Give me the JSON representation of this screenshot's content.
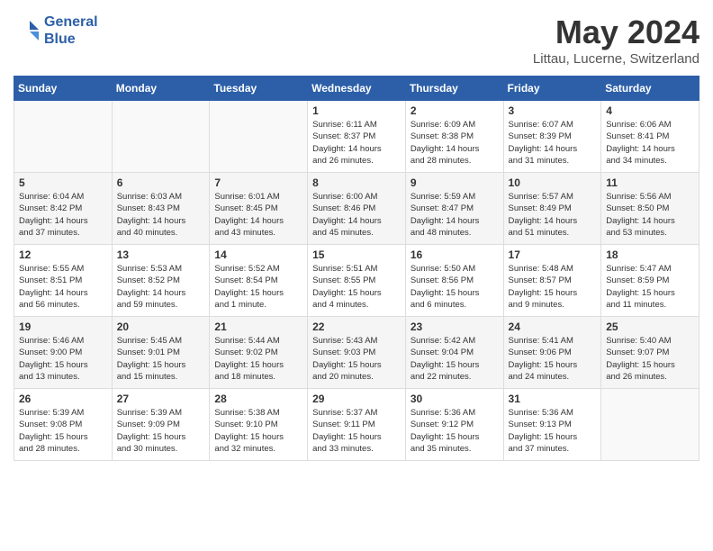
{
  "header": {
    "logo_line1": "General",
    "logo_line2": "Blue",
    "title": "May 2024",
    "subtitle": "Littau, Lucerne, Switzerland"
  },
  "weekdays": [
    "Sunday",
    "Monday",
    "Tuesday",
    "Wednesday",
    "Thursday",
    "Friday",
    "Saturday"
  ],
  "weeks": [
    [
      {
        "day": "",
        "text": ""
      },
      {
        "day": "",
        "text": ""
      },
      {
        "day": "",
        "text": ""
      },
      {
        "day": "1",
        "text": "Sunrise: 6:11 AM\nSunset: 8:37 PM\nDaylight: 14 hours\nand 26 minutes."
      },
      {
        "day": "2",
        "text": "Sunrise: 6:09 AM\nSunset: 8:38 PM\nDaylight: 14 hours\nand 28 minutes."
      },
      {
        "day": "3",
        "text": "Sunrise: 6:07 AM\nSunset: 8:39 PM\nDaylight: 14 hours\nand 31 minutes."
      },
      {
        "day": "4",
        "text": "Sunrise: 6:06 AM\nSunset: 8:41 PM\nDaylight: 14 hours\nand 34 minutes."
      }
    ],
    [
      {
        "day": "5",
        "text": "Sunrise: 6:04 AM\nSunset: 8:42 PM\nDaylight: 14 hours\nand 37 minutes."
      },
      {
        "day": "6",
        "text": "Sunrise: 6:03 AM\nSunset: 8:43 PM\nDaylight: 14 hours\nand 40 minutes."
      },
      {
        "day": "7",
        "text": "Sunrise: 6:01 AM\nSunset: 8:45 PM\nDaylight: 14 hours\nand 43 minutes."
      },
      {
        "day": "8",
        "text": "Sunrise: 6:00 AM\nSunset: 8:46 PM\nDaylight: 14 hours\nand 45 minutes."
      },
      {
        "day": "9",
        "text": "Sunrise: 5:59 AM\nSunset: 8:47 PM\nDaylight: 14 hours\nand 48 minutes."
      },
      {
        "day": "10",
        "text": "Sunrise: 5:57 AM\nSunset: 8:49 PM\nDaylight: 14 hours\nand 51 minutes."
      },
      {
        "day": "11",
        "text": "Sunrise: 5:56 AM\nSunset: 8:50 PM\nDaylight: 14 hours\nand 53 minutes."
      }
    ],
    [
      {
        "day": "12",
        "text": "Sunrise: 5:55 AM\nSunset: 8:51 PM\nDaylight: 14 hours\nand 56 minutes."
      },
      {
        "day": "13",
        "text": "Sunrise: 5:53 AM\nSunset: 8:52 PM\nDaylight: 14 hours\nand 59 minutes."
      },
      {
        "day": "14",
        "text": "Sunrise: 5:52 AM\nSunset: 8:54 PM\nDaylight: 15 hours\nand 1 minute."
      },
      {
        "day": "15",
        "text": "Sunrise: 5:51 AM\nSunset: 8:55 PM\nDaylight: 15 hours\nand 4 minutes."
      },
      {
        "day": "16",
        "text": "Sunrise: 5:50 AM\nSunset: 8:56 PM\nDaylight: 15 hours\nand 6 minutes."
      },
      {
        "day": "17",
        "text": "Sunrise: 5:48 AM\nSunset: 8:57 PM\nDaylight: 15 hours\nand 9 minutes."
      },
      {
        "day": "18",
        "text": "Sunrise: 5:47 AM\nSunset: 8:59 PM\nDaylight: 15 hours\nand 11 minutes."
      }
    ],
    [
      {
        "day": "19",
        "text": "Sunrise: 5:46 AM\nSunset: 9:00 PM\nDaylight: 15 hours\nand 13 minutes."
      },
      {
        "day": "20",
        "text": "Sunrise: 5:45 AM\nSunset: 9:01 PM\nDaylight: 15 hours\nand 15 minutes."
      },
      {
        "day": "21",
        "text": "Sunrise: 5:44 AM\nSunset: 9:02 PM\nDaylight: 15 hours\nand 18 minutes."
      },
      {
        "day": "22",
        "text": "Sunrise: 5:43 AM\nSunset: 9:03 PM\nDaylight: 15 hours\nand 20 minutes."
      },
      {
        "day": "23",
        "text": "Sunrise: 5:42 AM\nSunset: 9:04 PM\nDaylight: 15 hours\nand 22 minutes."
      },
      {
        "day": "24",
        "text": "Sunrise: 5:41 AM\nSunset: 9:06 PM\nDaylight: 15 hours\nand 24 minutes."
      },
      {
        "day": "25",
        "text": "Sunrise: 5:40 AM\nSunset: 9:07 PM\nDaylight: 15 hours\nand 26 minutes."
      }
    ],
    [
      {
        "day": "26",
        "text": "Sunrise: 5:39 AM\nSunset: 9:08 PM\nDaylight: 15 hours\nand 28 minutes."
      },
      {
        "day": "27",
        "text": "Sunrise: 5:39 AM\nSunset: 9:09 PM\nDaylight: 15 hours\nand 30 minutes."
      },
      {
        "day": "28",
        "text": "Sunrise: 5:38 AM\nSunset: 9:10 PM\nDaylight: 15 hours\nand 32 minutes."
      },
      {
        "day": "29",
        "text": "Sunrise: 5:37 AM\nSunset: 9:11 PM\nDaylight: 15 hours\nand 33 minutes."
      },
      {
        "day": "30",
        "text": "Sunrise: 5:36 AM\nSunset: 9:12 PM\nDaylight: 15 hours\nand 35 minutes."
      },
      {
        "day": "31",
        "text": "Sunrise: 5:36 AM\nSunset: 9:13 PM\nDaylight: 15 hours\nand 37 minutes."
      },
      {
        "day": "",
        "text": ""
      }
    ]
  ]
}
